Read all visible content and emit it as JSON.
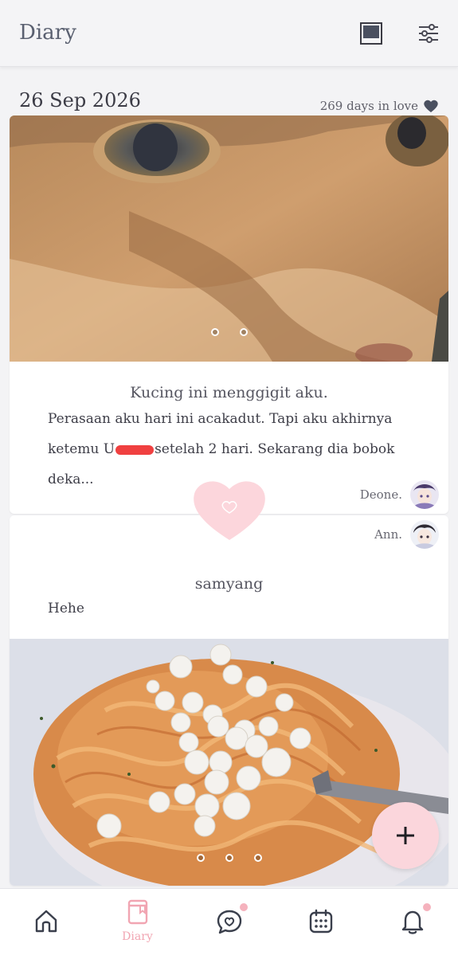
{
  "app": {
    "title": "Diary"
  },
  "header": {
    "date": "26 Sep 2026",
    "days_in_love": "269 days in love"
  },
  "entries": [
    {
      "title": "Kucing ini menggigit aku.",
      "body_line1": "Perasaan aku hari ini acakadut. Tapi aku akhirnya",
      "body_line2_pre": "ketemu U",
      "body_line2_post": "setelah 2 hari. Sekarang dia bobok deka...",
      "author": "Deone.",
      "photo_count": 2
    },
    {
      "title": "samyang",
      "body": "Hehe",
      "author": "Ann.",
      "photo_count": 3
    }
  ],
  "nav": {
    "items": [
      {
        "name": "home",
        "label": ""
      },
      {
        "name": "diary",
        "label": "Diary"
      },
      {
        "name": "chat",
        "label": ""
      },
      {
        "name": "calendar",
        "label": ""
      },
      {
        "name": "notifications",
        "label": ""
      }
    ]
  },
  "colors": {
    "accent_pink": "#f1a5b2",
    "fab_pink": "#fbd6dc",
    "heart_pink": "#fcd6dc",
    "redaction": "#f04040"
  }
}
